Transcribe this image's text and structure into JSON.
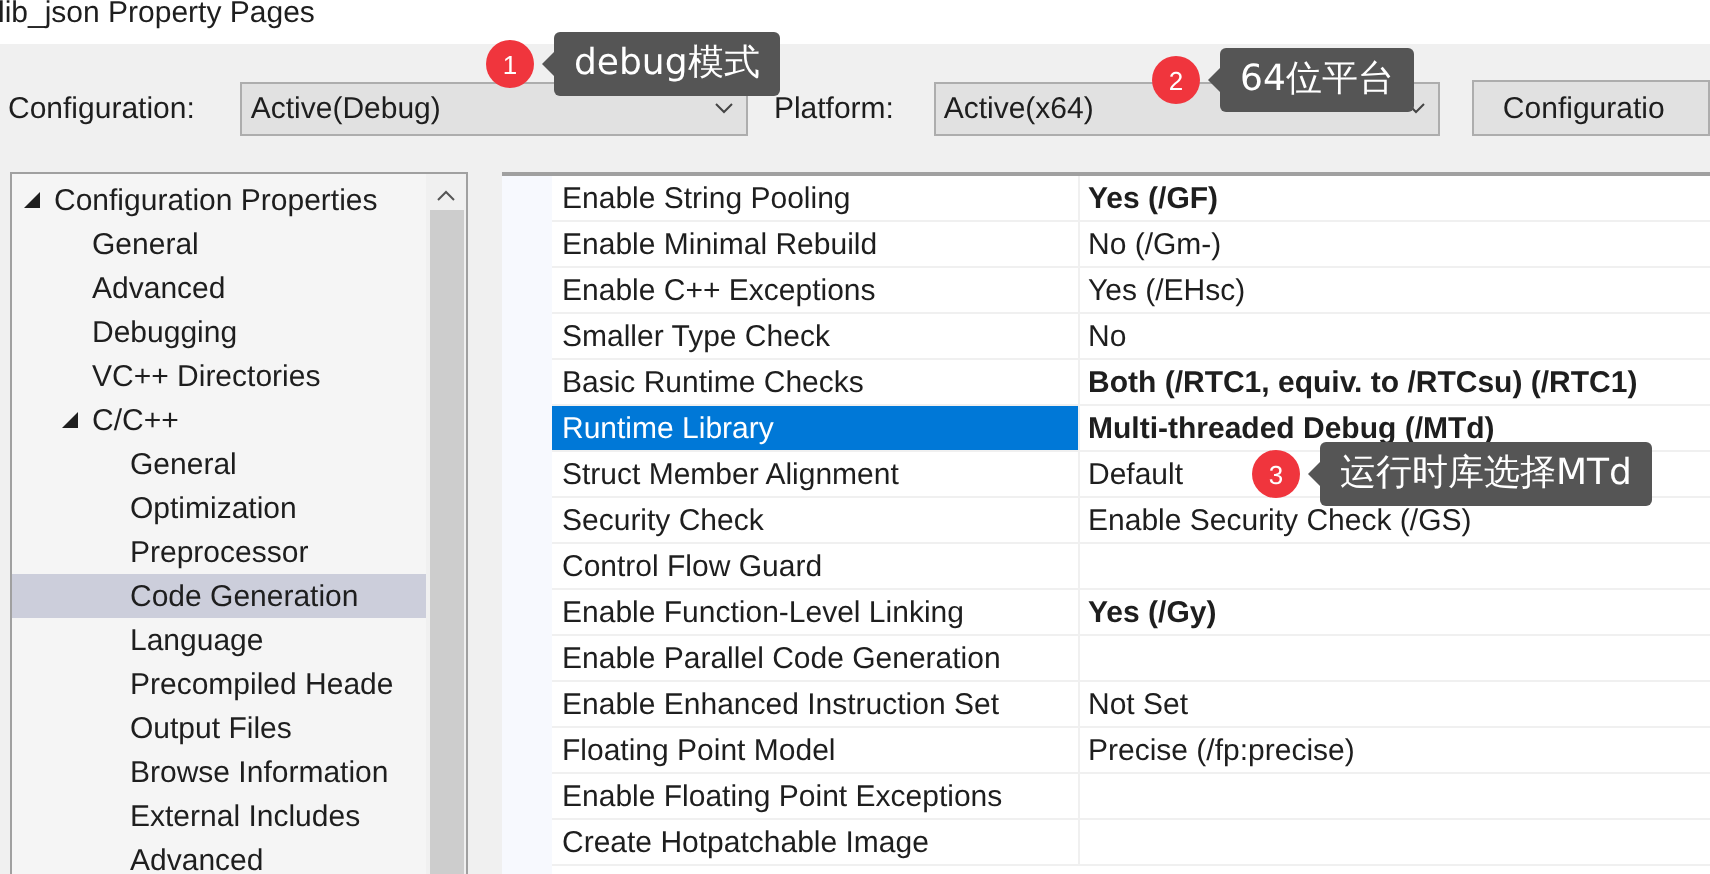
{
  "window": {
    "title": "lib_json Property Pages"
  },
  "toolbar": {
    "configuration_label": "Configuration:",
    "configuration_value": "Active(Debug)",
    "platform_label": "Platform:",
    "platform_value": "Active(x64)",
    "button": "Configuratio"
  },
  "tree": [
    {
      "label": "Configuration Properties",
      "expanded": true,
      "selected": false,
      "children": [
        {
          "label": "General",
          "selected": false
        },
        {
          "label": "Advanced",
          "selected": false
        },
        {
          "label": "Debugging",
          "selected": false
        },
        {
          "label": "VC++ Directories",
          "selected": false
        },
        {
          "label": "C/C++",
          "expanded": true,
          "selected": false,
          "children": [
            {
              "label": "General",
              "selected": false
            },
            {
              "label": "Optimization",
              "selected": false
            },
            {
              "label": "Preprocessor",
              "selected": false
            },
            {
              "label": "Code Generation",
              "selected": true
            },
            {
              "label": "Language",
              "selected": false
            },
            {
              "label": "Precompiled Heade",
              "selected": false
            },
            {
              "label": "Output Files",
              "selected": false
            },
            {
              "label": "Browse Information",
              "selected": false
            },
            {
              "label": "External Includes",
              "selected": false
            },
            {
              "label": "Advanced",
              "selected": false
            }
          ]
        }
      ]
    }
  ],
  "properties": [
    {
      "name": "Enable String Pooling",
      "value": "Yes (/GF)",
      "modified": true,
      "selected": false
    },
    {
      "name": "Enable Minimal Rebuild",
      "value": "No (/Gm-)",
      "modified": false,
      "selected": false
    },
    {
      "name": "Enable C++ Exceptions",
      "value": "Yes (/EHsc)",
      "modified": false,
      "selected": false
    },
    {
      "name": "Smaller Type Check",
      "value": "No",
      "modified": false,
      "selected": false
    },
    {
      "name": "Basic Runtime Checks",
      "value": "Both (/RTC1, equiv. to /RTCsu) (/RTC1)",
      "modified": true,
      "selected": false
    },
    {
      "name": "Runtime Library",
      "value": "Multi-threaded Debug (/MTd)",
      "modified": true,
      "selected": true
    },
    {
      "name": "Struct Member Alignment",
      "value": "Default",
      "modified": false,
      "selected": false
    },
    {
      "name": "Security Check",
      "value": "Enable Security Check (/GS)",
      "modified": false,
      "selected": false
    },
    {
      "name": "Control Flow Guard",
      "selected": false
    },
    {
      "name": "Enable Function-Level Linking",
      "value": "Yes (/Gy)",
      "modified": true,
      "selected": false
    },
    {
      "name": "Enable Parallel Code Generation",
      "selected": false
    },
    {
      "name": "Enable Enhanced Instruction Set",
      "value": "Not Set",
      "modified": false,
      "selected": false
    },
    {
      "name": "Floating Point Model",
      "value": "Precise (/fp:precise)",
      "modified": false,
      "selected": false
    },
    {
      "name": "Enable Floating Point Exceptions",
      "selected": false
    },
    {
      "name": "Create Hotpatchable Image",
      "selected": false
    }
  ],
  "annotations": [
    {
      "number": "1",
      "text": "debug模式"
    },
    {
      "number": "2",
      "text": "64位平台"
    },
    {
      "number": "3",
      "text": "运行时库选择MTd"
    }
  ]
}
